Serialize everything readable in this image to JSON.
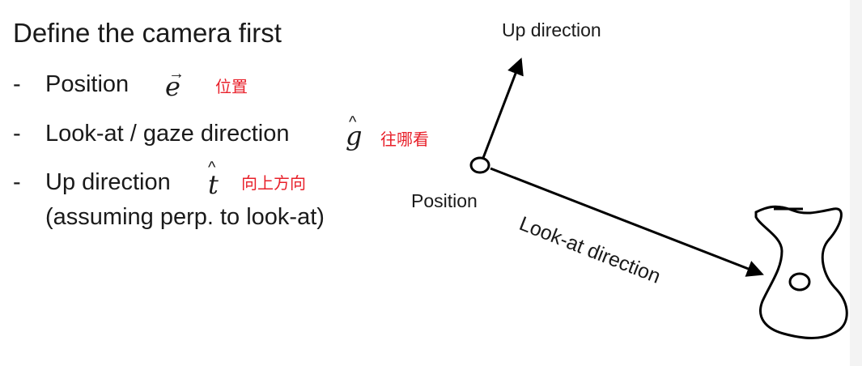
{
  "title": "Define the camera first",
  "bullets": [
    {
      "dash": "-",
      "label": "Position",
      "symbol": "e",
      "accent": "→",
      "note": "位置"
    },
    {
      "dash": "-",
      "label": "Look-at / gaze direction",
      "symbol": "g",
      "accent": "^",
      "note": "往哪看"
    },
    {
      "dash": "-",
      "label": "Up direction",
      "symbol": "t",
      "accent": "^",
      "note": "向上方向",
      "sub": "(assuming perp. to look-at)"
    }
  ],
  "diagram": {
    "up_label": "Up direction",
    "position_label": "Position",
    "lookat_label": "Look-at direction"
  },
  "colors": {
    "note": "#e8202a",
    "text": "#1a1a1a"
  }
}
